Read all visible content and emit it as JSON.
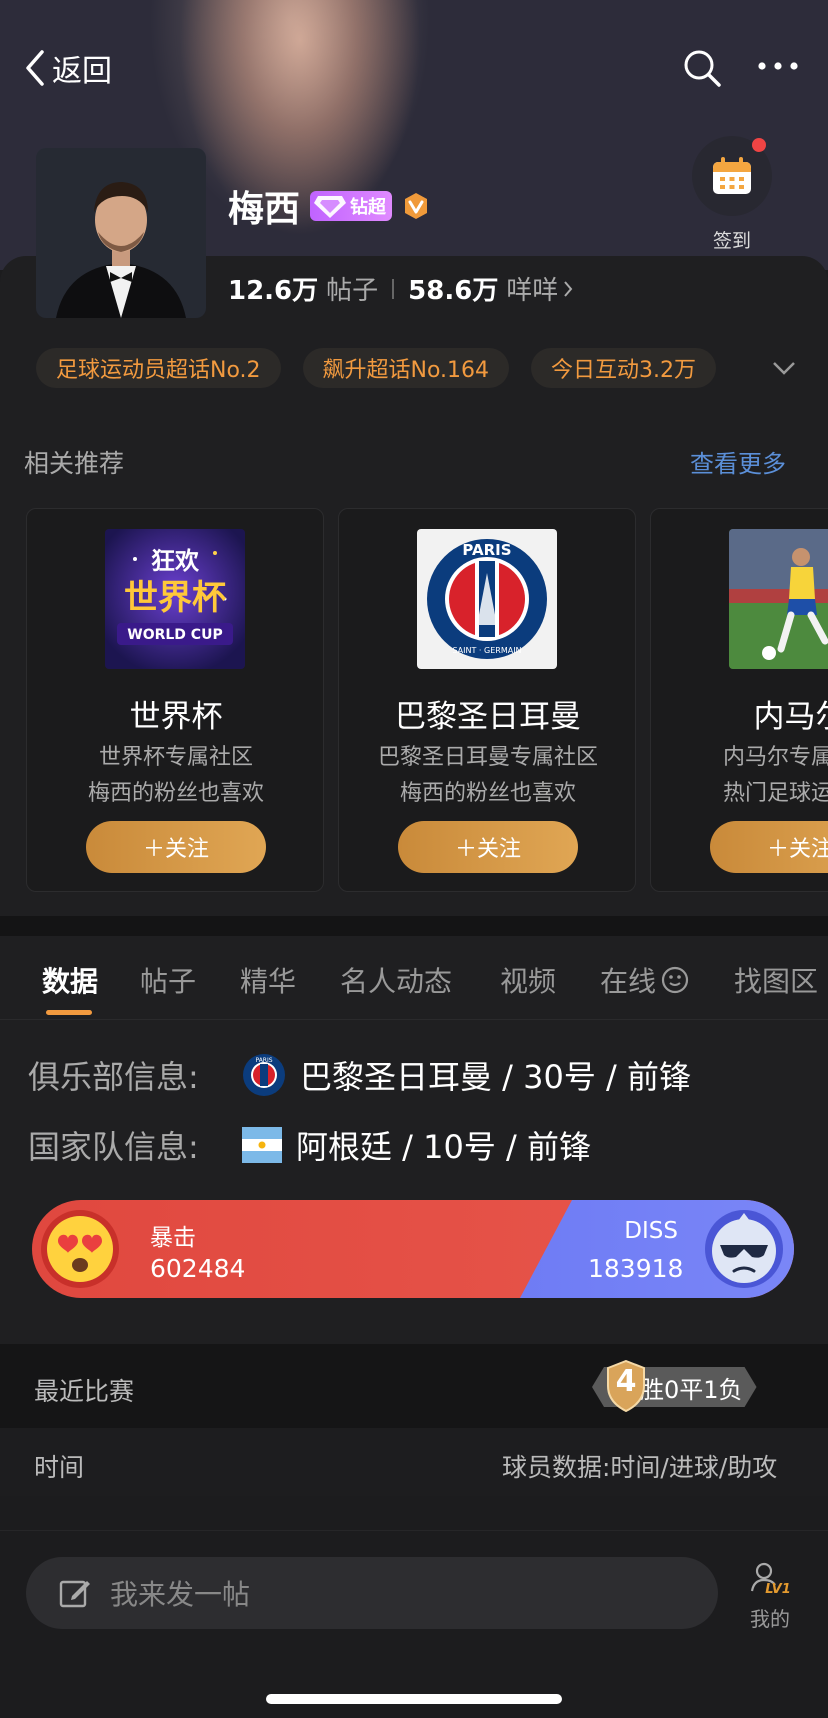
{
  "topbar": {
    "back_label": "返回"
  },
  "profile": {
    "name": "梅西",
    "badge_label": "钻超",
    "posts_count": "12.6万",
    "posts_label": "帖子",
    "fans_count": "58.6万",
    "fans_label": "咩咩",
    "checkin_label": "签到"
  },
  "tags": [
    "足球运动员超话No.2",
    "飙升超话No.164",
    "今日互动3.2万"
  ],
  "recommend": {
    "title": "相关推荐",
    "more": "查看更多",
    "cards": [
      {
        "title": "世界杯",
        "sub1": "世界杯专属社区",
        "sub2": "梅西的粉丝也喜欢",
        "follow": "＋关注",
        "img_text_top": "狂欢",
        "img_text_mid": "世界杯",
        "img_text_bot": "WORLD CUP"
      },
      {
        "title": "巴黎圣日耳曼",
        "sub1": "巴黎圣日耳曼专属社区",
        "sub2": "梅西的粉丝也喜欢",
        "follow": "＋关注",
        "img_text_top": "PARIS",
        "img_text_bot": "SAINT · GERMAIN"
      },
      {
        "title": "内马尔",
        "sub1": "内马尔专属社区",
        "sub2": "热门足球运动员",
        "follow": "＋关注"
      }
    ]
  },
  "tabs": [
    "数据",
    "帖子",
    "精华",
    "名人动态",
    "视频",
    "在线",
    "找图区"
  ],
  "info": {
    "club_label": "俱乐部信息:",
    "club_value": "巴黎圣日耳曼 / 30号 / 前锋",
    "club_logo_text": "PARIS",
    "national_label": "国家队信息:",
    "national_value": "阿根廷 / 10号 / 前锋"
  },
  "vs": {
    "left_label": "暴击",
    "left_value": "602484",
    "right_label": "DISS",
    "right_value": "183918"
  },
  "recent": {
    "label": "最近比赛",
    "wins": "4",
    "record_rest": "胜0平1负"
  },
  "table_header": {
    "left": "时间",
    "right": "球员数据:时间/进球/助攻"
  },
  "bottom": {
    "compose_placeholder": "我来发一帖",
    "mine_label": "我的",
    "level_badge": "LV1"
  },
  "colors": {
    "accent_orange": "#f29a3f",
    "link_blue": "#5b8fd8",
    "boost_red": "#e0483f",
    "diss_blue": "#5a6af0",
    "zc_badge_purple": "#c063ff"
  }
}
